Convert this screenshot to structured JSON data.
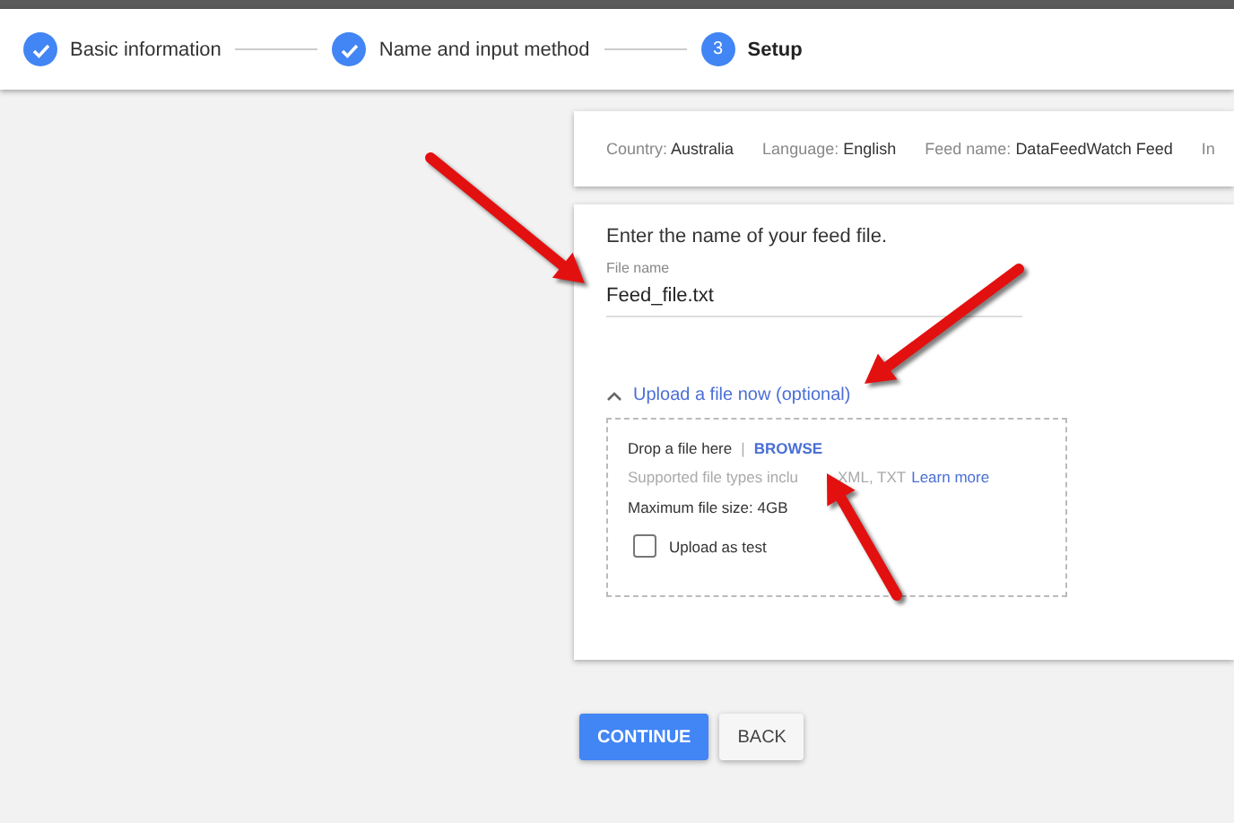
{
  "steps": [
    {
      "label": "Basic information",
      "completed": true
    },
    {
      "label": "Name and input method",
      "completed": true
    },
    {
      "label": "Setup",
      "completed": false,
      "number": "3"
    }
  ],
  "summary": [
    {
      "label": "Country:",
      "value": "Australia"
    },
    {
      "label": "Language:",
      "value": "English"
    },
    {
      "label": "Feed name:",
      "value": "DataFeedWatch Feed"
    },
    {
      "label": "In"
    }
  ],
  "form": {
    "prompt": "Enter the name of your feed file.",
    "field_label": "File name",
    "field_value": "Feed_file.txt",
    "upload": {
      "toggle": "Upload a file now (optional)",
      "expanded": true,
      "drop_text": "Drop a file here",
      "separator": "|",
      "browse": "BROWSE",
      "supported_start": "Supported file types inclu",
      "supported_end": "XML, TXT",
      "learn_more": "Learn more",
      "max_size": "Maximum file size: 4GB",
      "test_label": "Upload as test",
      "test_checked": false
    }
  },
  "buttons": [
    {
      "label": "CONTINUE",
      "kind": "primary"
    },
    {
      "label": "BACK",
      "kind": "secondary"
    }
  ]
}
